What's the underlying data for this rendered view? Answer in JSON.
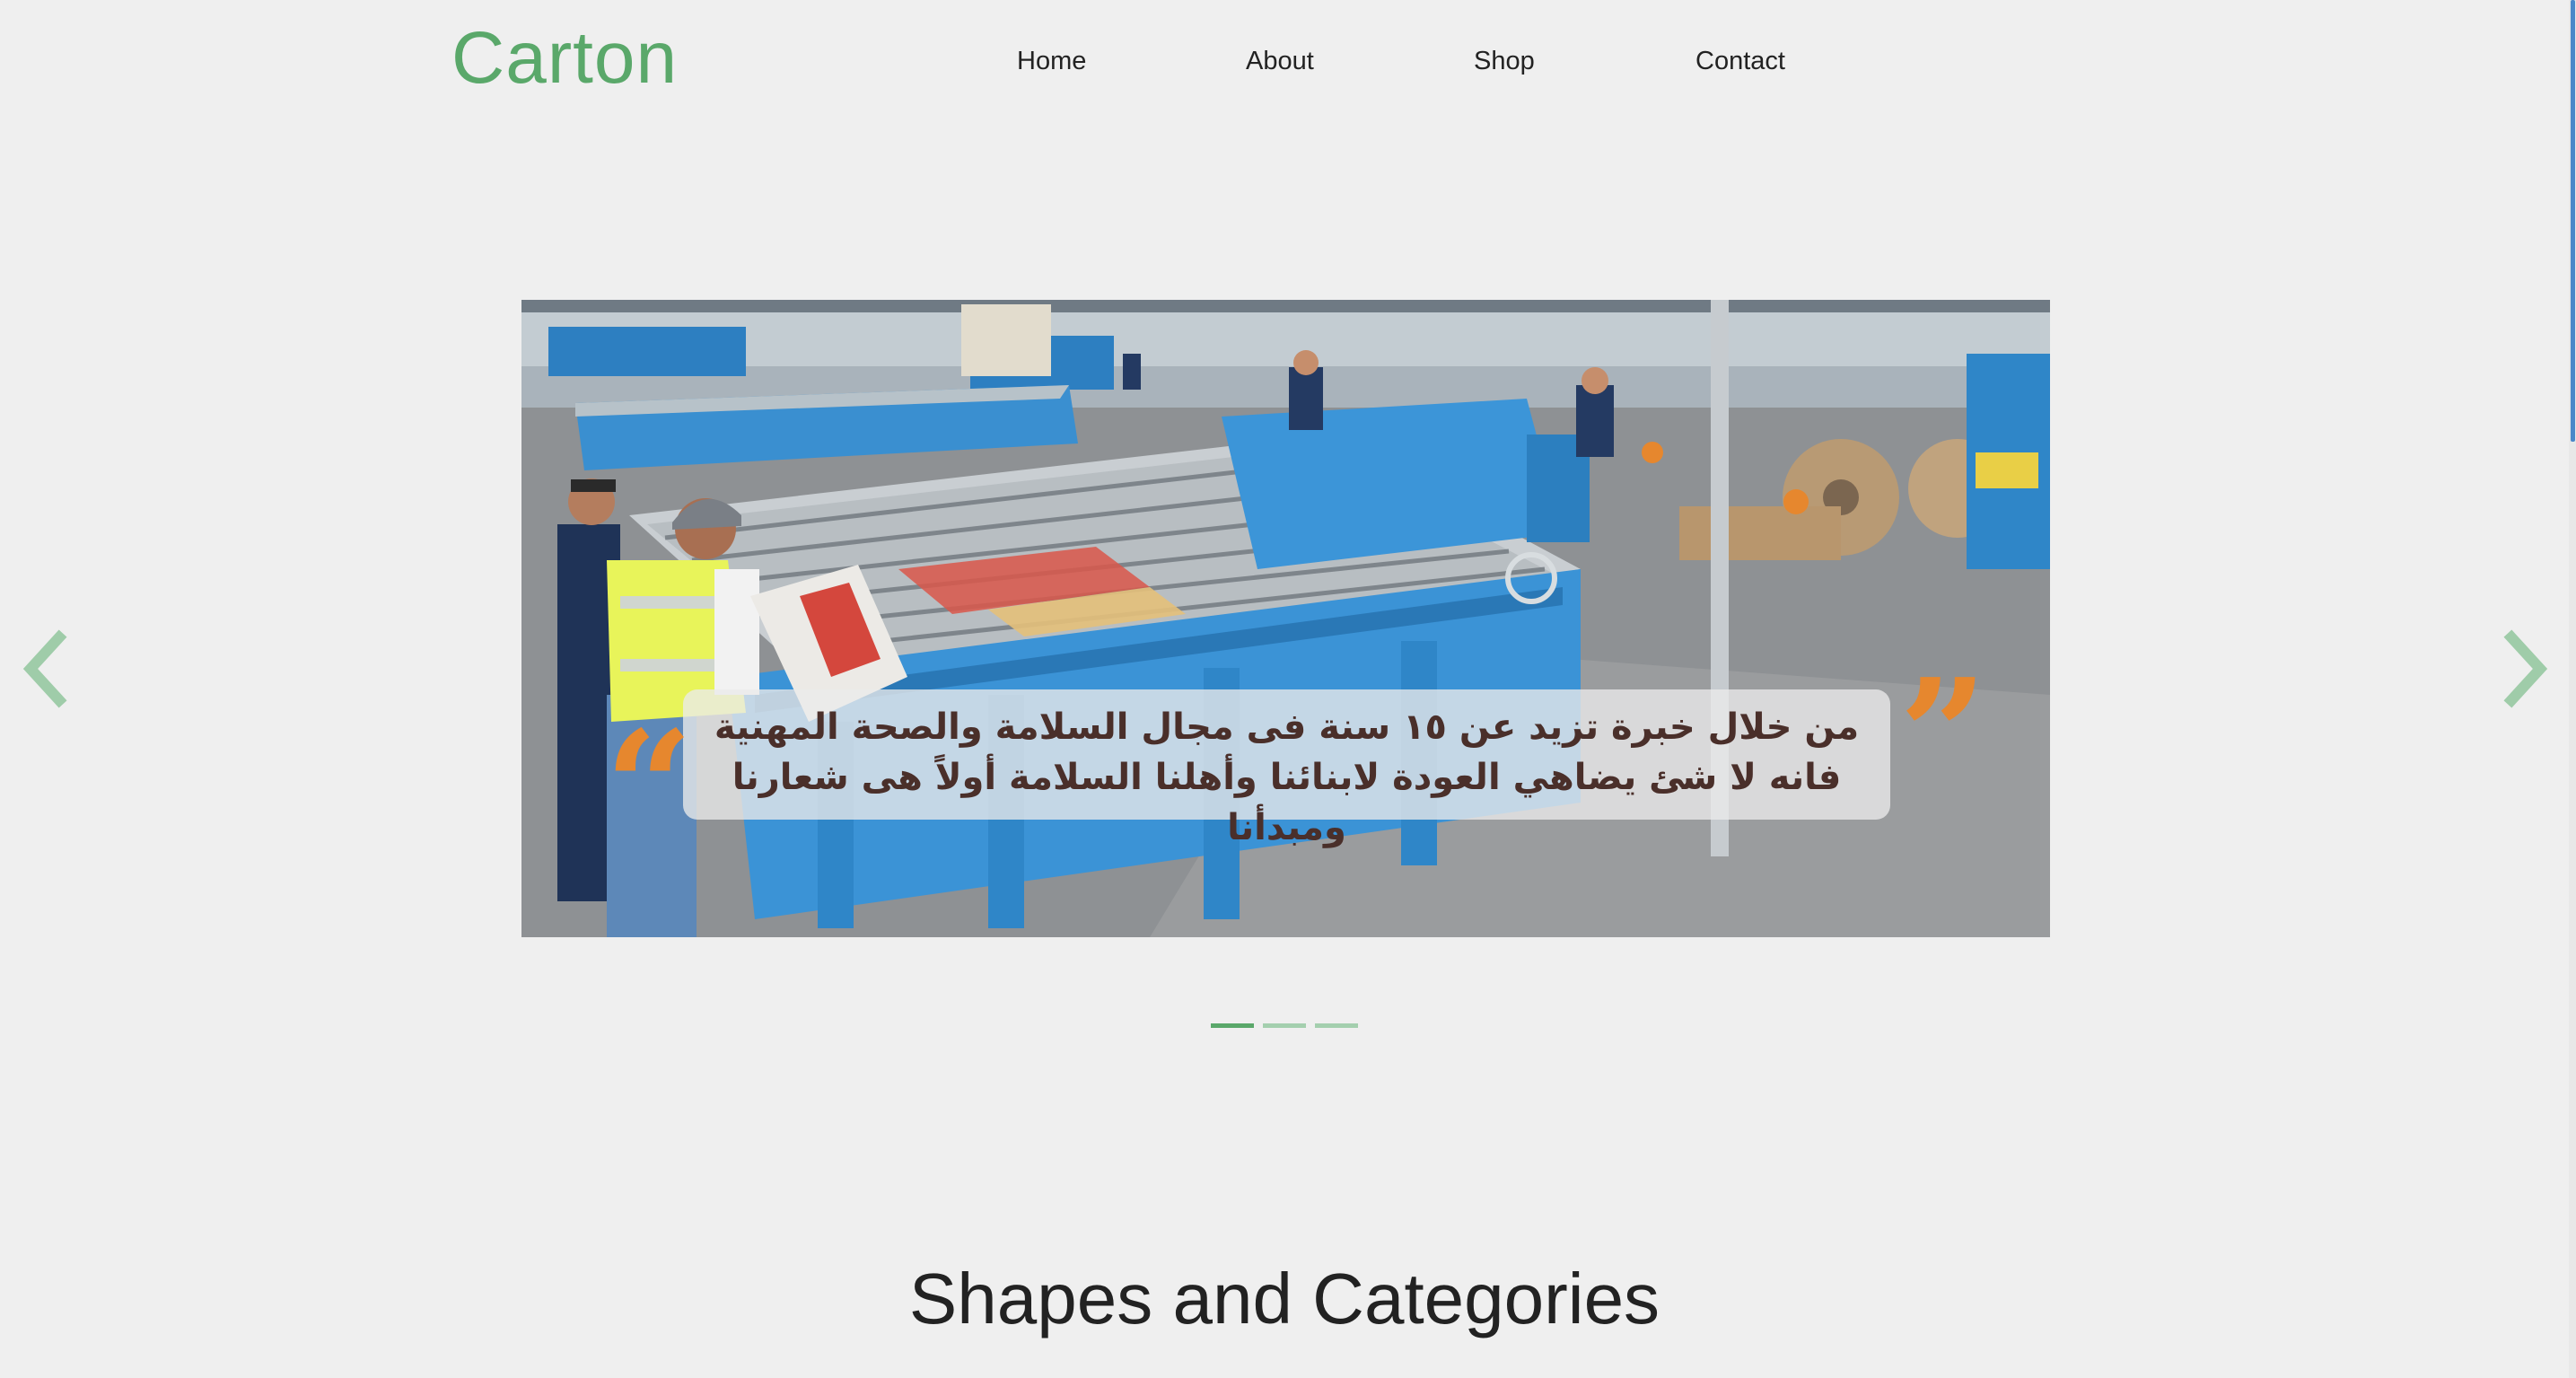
{
  "brand": {
    "name": "Carton",
    "color": "#5aa86a"
  },
  "nav": {
    "items": [
      "Home",
      "About",
      "Shop",
      "Contact"
    ]
  },
  "carousel": {
    "caption_line1": "من خلال خبرة تزيد عن ١٥ سنة فى مجال السلامة والصحة المهنية",
    "caption_line2": "فانه لا شئ يضاهي العودة لابنائنا وأهلنا السلامة أولاً هى شعارنا ومبدأنا",
    "quote_open": "”",
    "quote_close": "“",
    "slide_count": 3,
    "active_index": 0,
    "prev_icon": "chevron-left-icon",
    "next_icon": "chevron-right-icon",
    "accent_color": "#e6872e"
  },
  "section": {
    "title": "Shapes and Categories"
  }
}
